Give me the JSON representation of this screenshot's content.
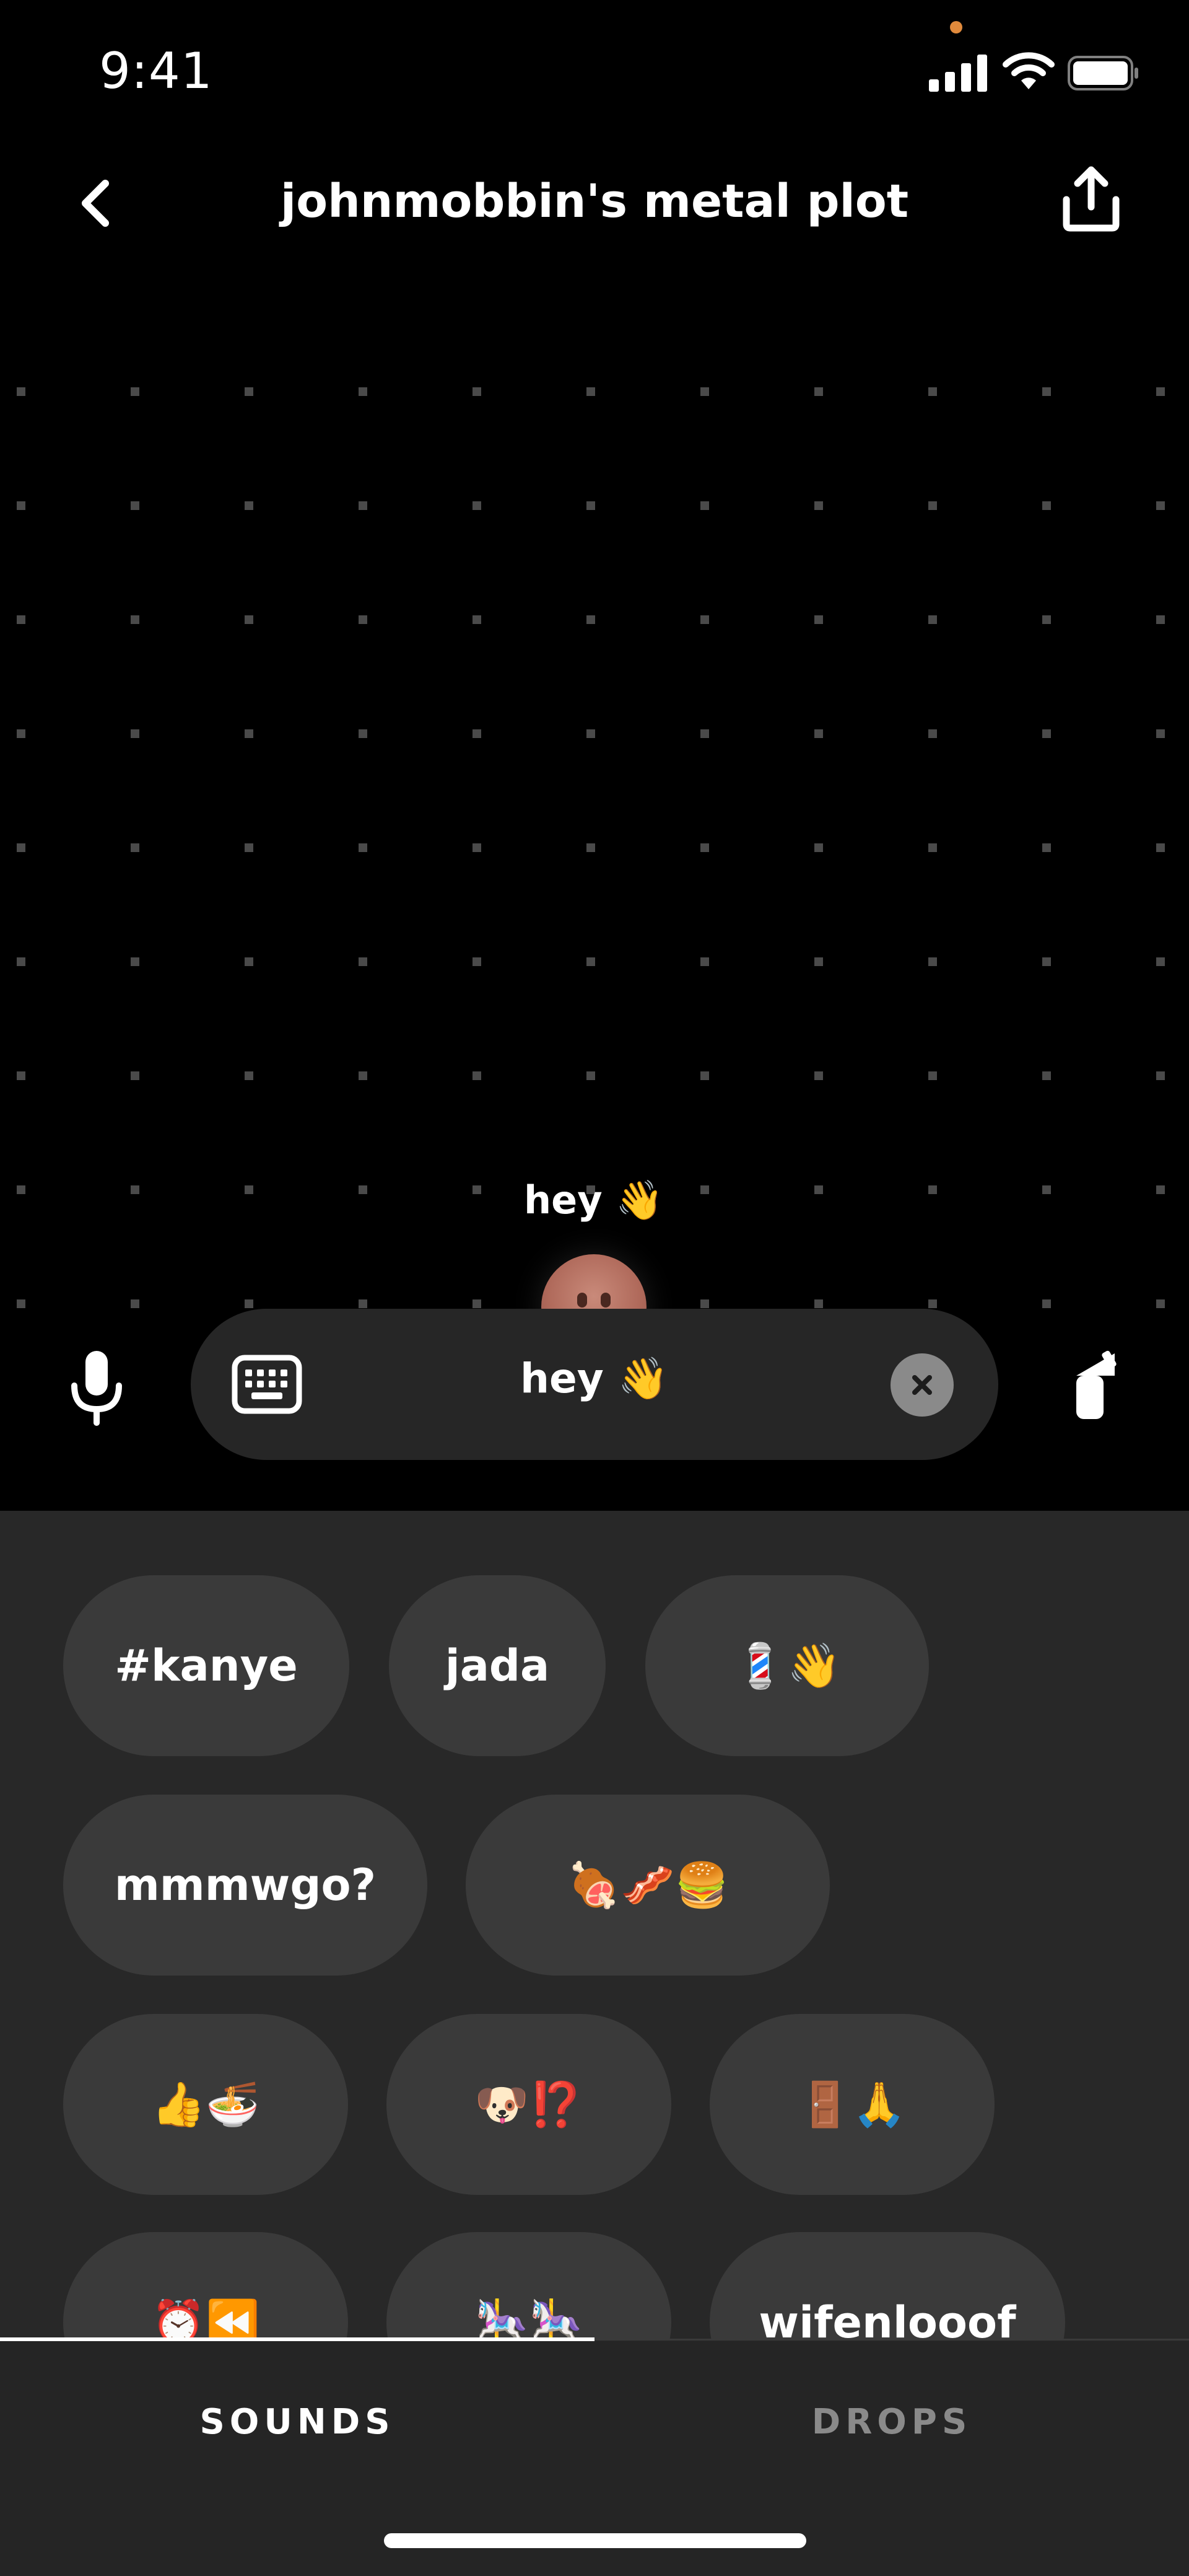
{
  "status_bar": {
    "time": "9:41"
  },
  "header": {
    "title": "johnmobbin's metal plot"
  },
  "bubble": {
    "text": "hey 👋"
  },
  "input": {
    "text": "hey 👋"
  },
  "chips": [
    "#kanye",
    "jada",
    "💈👋",
    "mmmwgo?",
    "🍖🥓🍔",
    "👍🍜",
    "🐶⁉️",
    "🚪🙏",
    "⏰⏪",
    "🎠🎠",
    "wifenlooof"
  ],
  "tabs": {
    "sounds": "SOUNDS",
    "drops": "DROPS"
  },
  "icons": [
    "back-icon",
    "share-icon",
    "signal-icon",
    "wifi-icon",
    "battery-icon",
    "mic-icon",
    "keyboard-icon",
    "close-icon",
    "camera-icon"
  ]
}
